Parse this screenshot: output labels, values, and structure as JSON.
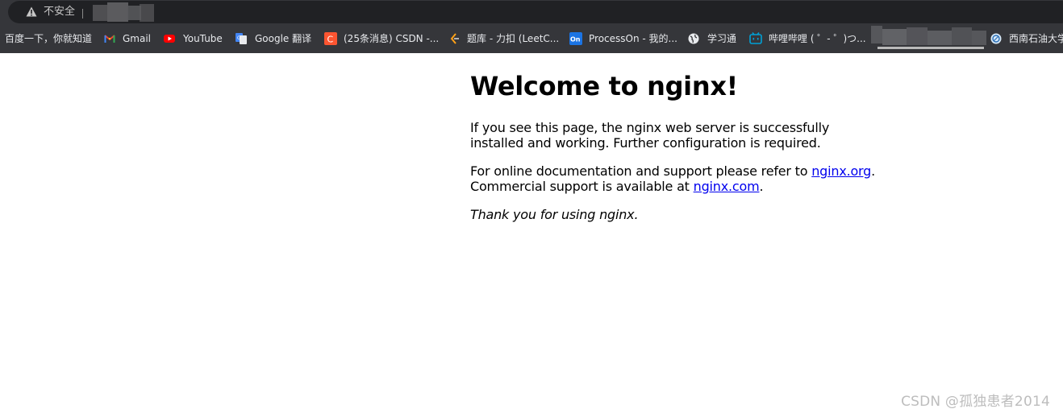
{
  "browser": {
    "security_label": "不安全",
    "bookmarks": [
      {
        "label": "百度一下，你就知道",
        "icon": "none"
      },
      {
        "label": "Gmail",
        "icon": "gmail-icon"
      },
      {
        "label": "YouTube",
        "icon": "youtube-icon"
      },
      {
        "label": "Google 翻译",
        "icon": "google-translate-icon"
      },
      {
        "label": "(25条消息) CSDN -...",
        "icon": "csdn-icon"
      },
      {
        "label": "题库 - 力扣 (LeetC...",
        "icon": "leetcode-icon"
      },
      {
        "label": "ProcessOn - 我的...",
        "icon": "processon-icon"
      },
      {
        "label": "学习通",
        "icon": "globe-icon"
      },
      {
        "label": "哔哩哔哩 ( ゜- ゜)つ...",
        "icon": "bilibili-icon"
      },
      {
        "label": "西南石油大学",
        "icon": "university-icon"
      }
    ]
  },
  "page": {
    "heading": "Welcome to nginx!",
    "p1": "If you see this page, the nginx web server is successfully installed and working. Further configuration is required.",
    "p2_prefix": "For online documentation and support please refer to ",
    "link_org": "nginx.org",
    "p2_mid": ".",
    "p2_line2_prefix": "Commercial support is available at ",
    "link_com": "nginx.com",
    "p2_end": ".",
    "p3": "Thank you for using nginx."
  },
  "watermark": "CSDN @孤独患者2014",
  "colors": {
    "toolbar_bg": "#35363a",
    "omnibox_bg": "#202124",
    "link": "#0000ee"
  }
}
